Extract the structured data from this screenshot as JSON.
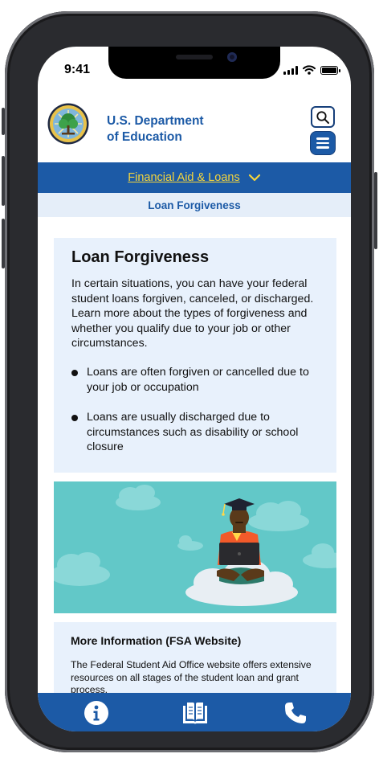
{
  "status": {
    "time": "9:41"
  },
  "header": {
    "dept_line1": "U.S. Department",
    "dept_line2": "of Education",
    "seal_icon": "department-seal",
    "search_icon": "search-icon",
    "menu_icon": "hamburger-menu-icon"
  },
  "nav": {
    "menu_label": "Financial Aid & Loans",
    "breadcrumb": "Loan Forgiveness"
  },
  "main": {
    "title": "Loan Forgiveness",
    "intro": "In certain situations, you can have your federal student loans forgiven, canceled, or discharged.  Learn more about the types of forgiveness and whether you qualify due to your job or other circumstances.",
    "bullets": [
      "Loans are often forgiven or cancelled due to your job or occupation",
      "Loans are usually discharged due to circumstances such as disability or school closure"
    ]
  },
  "more_info": {
    "title": "More Information (FSA Website)",
    "text": "The Federal Student Aid Office website offers extensive resources on all stages of the student loan and grant process."
  },
  "tabbar": {
    "items": [
      "info-icon",
      "book-icon",
      "phone-icon"
    ]
  },
  "colors": {
    "primary": "#1c5aa6",
    "accent": "#f5d53c",
    "card_bg": "#e8f1fc",
    "illustration_bg": "#62c8c8"
  }
}
